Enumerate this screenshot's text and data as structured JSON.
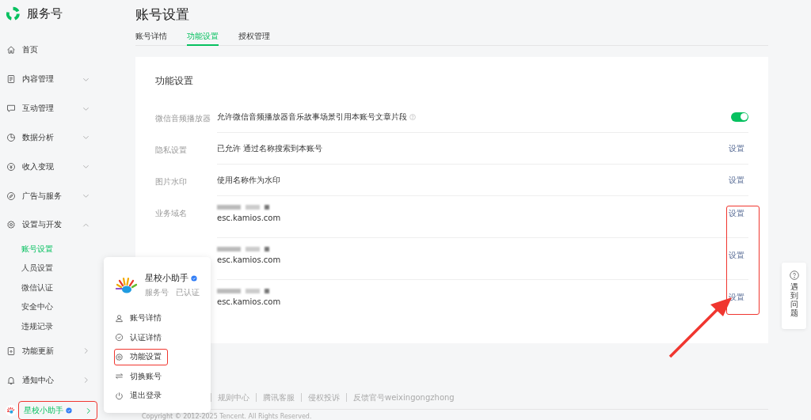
{
  "brand": {
    "name": "服务号"
  },
  "sidebar": {
    "items": [
      {
        "label": "首页",
        "kind": "link"
      },
      {
        "label": "内容管理",
        "kind": "group",
        "expanded": false
      },
      {
        "label": "互动管理",
        "kind": "group",
        "expanded": false
      },
      {
        "label": "数据分析",
        "kind": "group",
        "expanded": false
      },
      {
        "label": "收入变现",
        "kind": "group",
        "expanded": false
      },
      {
        "label": "广告与服务",
        "kind": "group",
        "expanded": false
      },
      {
        "label": "设置与开发",
        "kind": "group",
        "expanded": true,
        "children": [
          {
            "label": "账号设置",
            "selected": true
          },
          {
            "label": "人员设置",
            "selected": false
          },
          {
            "label": "微信认证",
            "selected": false
          },
          {
            "label": "安全中心",
            "selected": false
          },
          {
            "label": "违规记录",
            "selected": false
          }
        ]
      },
      {
        "label": "功能更新",
        "kind": "more"
      },
      {
        "label": "通知中心",
        "kind": "more"
      }
    ],
    "account": {
      "name": "星校小助手",
      "verified": true
    }
  },
  "page": {
    "title": "账号设置",
    "tabs": [
      {
        "label": "账号详情",
        "selected": false
      },
      {
        "label": "功能设置",
        "selected": true
      },
      {
        "label": "授权管理",
        "selected": false
      }
    ]
  },
  "card": {
    "title": "功能设置",
    "rows": [
      {
        "label": "微信音频播放器",
        "text": "允许微信音频播放器音乐故事场景引用本账号文章片段",
        "help": true,
        "kind": "toggle",
        "on": true
      },
      {
        "label": "隐私设置",
        "text": "已允许 通过名称搜索到本账号",
        "kind": "action",
        "action": "设置"
      },
      {
        "label": "图片水印",
        "text": "使用名称作为水印",
        "kind": "action",
        "action": "设置"
      },
      {
        "label": "业务域名",
        "redacted": true,
        "text": "esc.kamios.com",
        "kind": "action",
        "action": "设置"
      },
      {
        "redacted": true,
        "text": "esc.kamios.com",
        "kind": "action",
        "action": "设置"
      },
      {
        "redacted": true,
        "text": "esc.kamios.com",
        "kind": "action",
        "action": "设置"
      }
    ]
  },
  "popup": {
    "name": "星校小助手",
    "verified": true,
    "type": "服务号",
    "status": "已认证",
    "items": [
      "账号详情",
      "认证详情",
      "功能设置",
      "切换账号",
      "退出登录"
    ]
  },
  "footer": {
    "links": [
      "规则中心",
      "腾讯客服",
      "侵权投诉",
      "反馈官号weixingongzhong"
    ],
    "copyright": "Copyright © 2012-2025 Tencent. All Rights Reserved."
  },
  "help": {
    "label": "遇到问题"
  }
}
